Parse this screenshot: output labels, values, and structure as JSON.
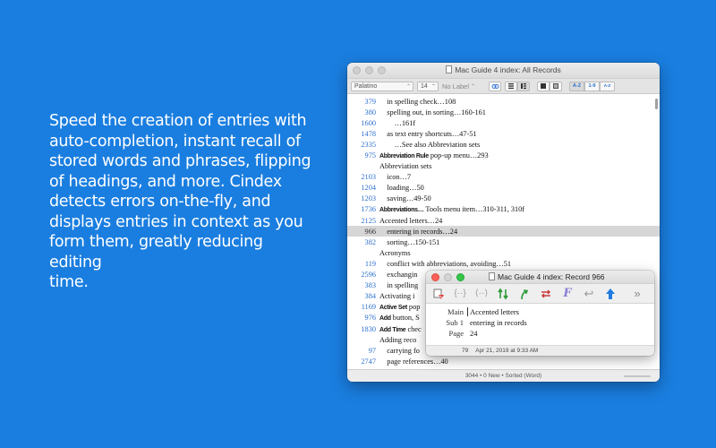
{
  "promo_text": "Speed the creation of entries with\n auto-completion, instant recall of\nstored words and phrases, flipping\nof headings, and more. Cindex\ndetects errors on-the-fly, and\ndisplays entries in context as you\nform them, greatly reducing editing\ntime.",
  "main_window": {
    "title": "Mac Guide 4 index: All Records",
    "toolbar": {
      "font": "Palatino",
      "size": "14",
      "label": "No Label",
      "sort_az": "A-Z",
      "sort_19": "1-9",
      "sort_az_stack": "A-Z"
    },
    "rows": [
      {
        "num": "379",
        "text": "    in spelling check…108",
        "bold": "",
        "selected": false
      },
      {
        "num": "380",
        "text": "    spelling out, in sorting…160-161",
        "bold": "",
        "selected": false
      },
      {
        "num": "1600",
        "text": "        …161f",
        "bold": "",
        "selected": false
      },
      {
        "num": "1478",
        "text": "    as text entry shortcuts…47-51",
        "bold": "",
        "selected": false
      },
      {
        "num": "2335",
        "text": "        …See also Abbreviation sets",
        "bold": "",
        "selected": false
      },
      {
        "num": "975",
        "text": " pop-up menu…293",
        "bold": "Abbreviation Rule",
        "selected": false
      },
      {
        "num": "",
        "text": "Abbreviation sets",
        "bold": "",
        "selected": false
      },
      {
        "num": "2103",
        "text": "    icon…7",
        "bold": "",
        "selected": false
      },
      {
        "num": "1204",
        "text": "    loading…50",
        "bold": "",
        "selected": false
      },
      {
        "num": "1203",
        "text": "    saving…49-50",
        "bold": "",
        "selected": false
      },
      {
        "num": "1736",
        "text": " Tools menu item…310-311, 310f",
        "bold": "Abbreviations…",
        "selected": false
      },
      {
        "num": "2125",
        "text": "Accented letters…24",
        "bold": "",
        "selected": false
      },
      {
        "num": "966",
        "text": "    entering in records…24",
        "bold": "",
        "selected": true
      },
      {
        "num": "382",
        "text": "    sorting…150-151",
        "bold": "",
        "selected": false
      },
      {
        "num": "",
        "text": "Acronyms",
        "bold": "",
        "selected": false
      },
      {
        "num": "119",
        "text": "    conflict with abbreviations, avoiding…51",
        "bold": "",
        "selected": false
      },
      {
        "num": "2596",
        "text": "    exchangin",
        "bold": "",
        "selected": false
      },
      {
        "num": "383",
        "text": "    in spelling",
        "bold": "",
        "selected": false
      },
      {
        "num": "384",
        "text": "Activating i",
        "bold": "",
        "selected": false
      },
      {
        "num": "1169",
        "text": " pop",
        "bold": "Active Set",
        "selected": false
      },
      {
        "num": "976",
        "text": " button, S",
        "bold": "Add",
        "selected": false
      },
      {
        "num": "1830",
        "text": " chec",
        "bold": "Add Time",
        "selected": false
      },
      {
        "num": "",
        "text": "Adding reco",
        "bold": "",
        "selected": false
      },
      {
        "num": "97",
        "text": "    carrying fo",
        "bold": "",
        "selected": false
      },
      {
        "num": "2747",
        "text": "    page references…40",
        "bold": "",
        "selected": false
      }
    ],
    "status": "3044 • 0 New • Sorted (Word)"
  },
  "record_window": {
    "title": "Mac Guide 4 index: Record 966",
    "fields": [
      {
        "label": "Main",
        "value": "Accented letters"
      },
      {
        "label": "Sub 1",
        "value": "entering in records"
      },
      {
        "label": "Page",
        "value": "24"
      }
    ],
    "status_count": "79",
    "status_date": "Apr 21, 2019 at 9:33 AM",
    "overflow_glyph": "»"
  },
  "colors": {
    "background": "#1a7ee0",
    "link_number": "#2d6fcf",
    "selected_row": "#d6d6d6"
  }
}
